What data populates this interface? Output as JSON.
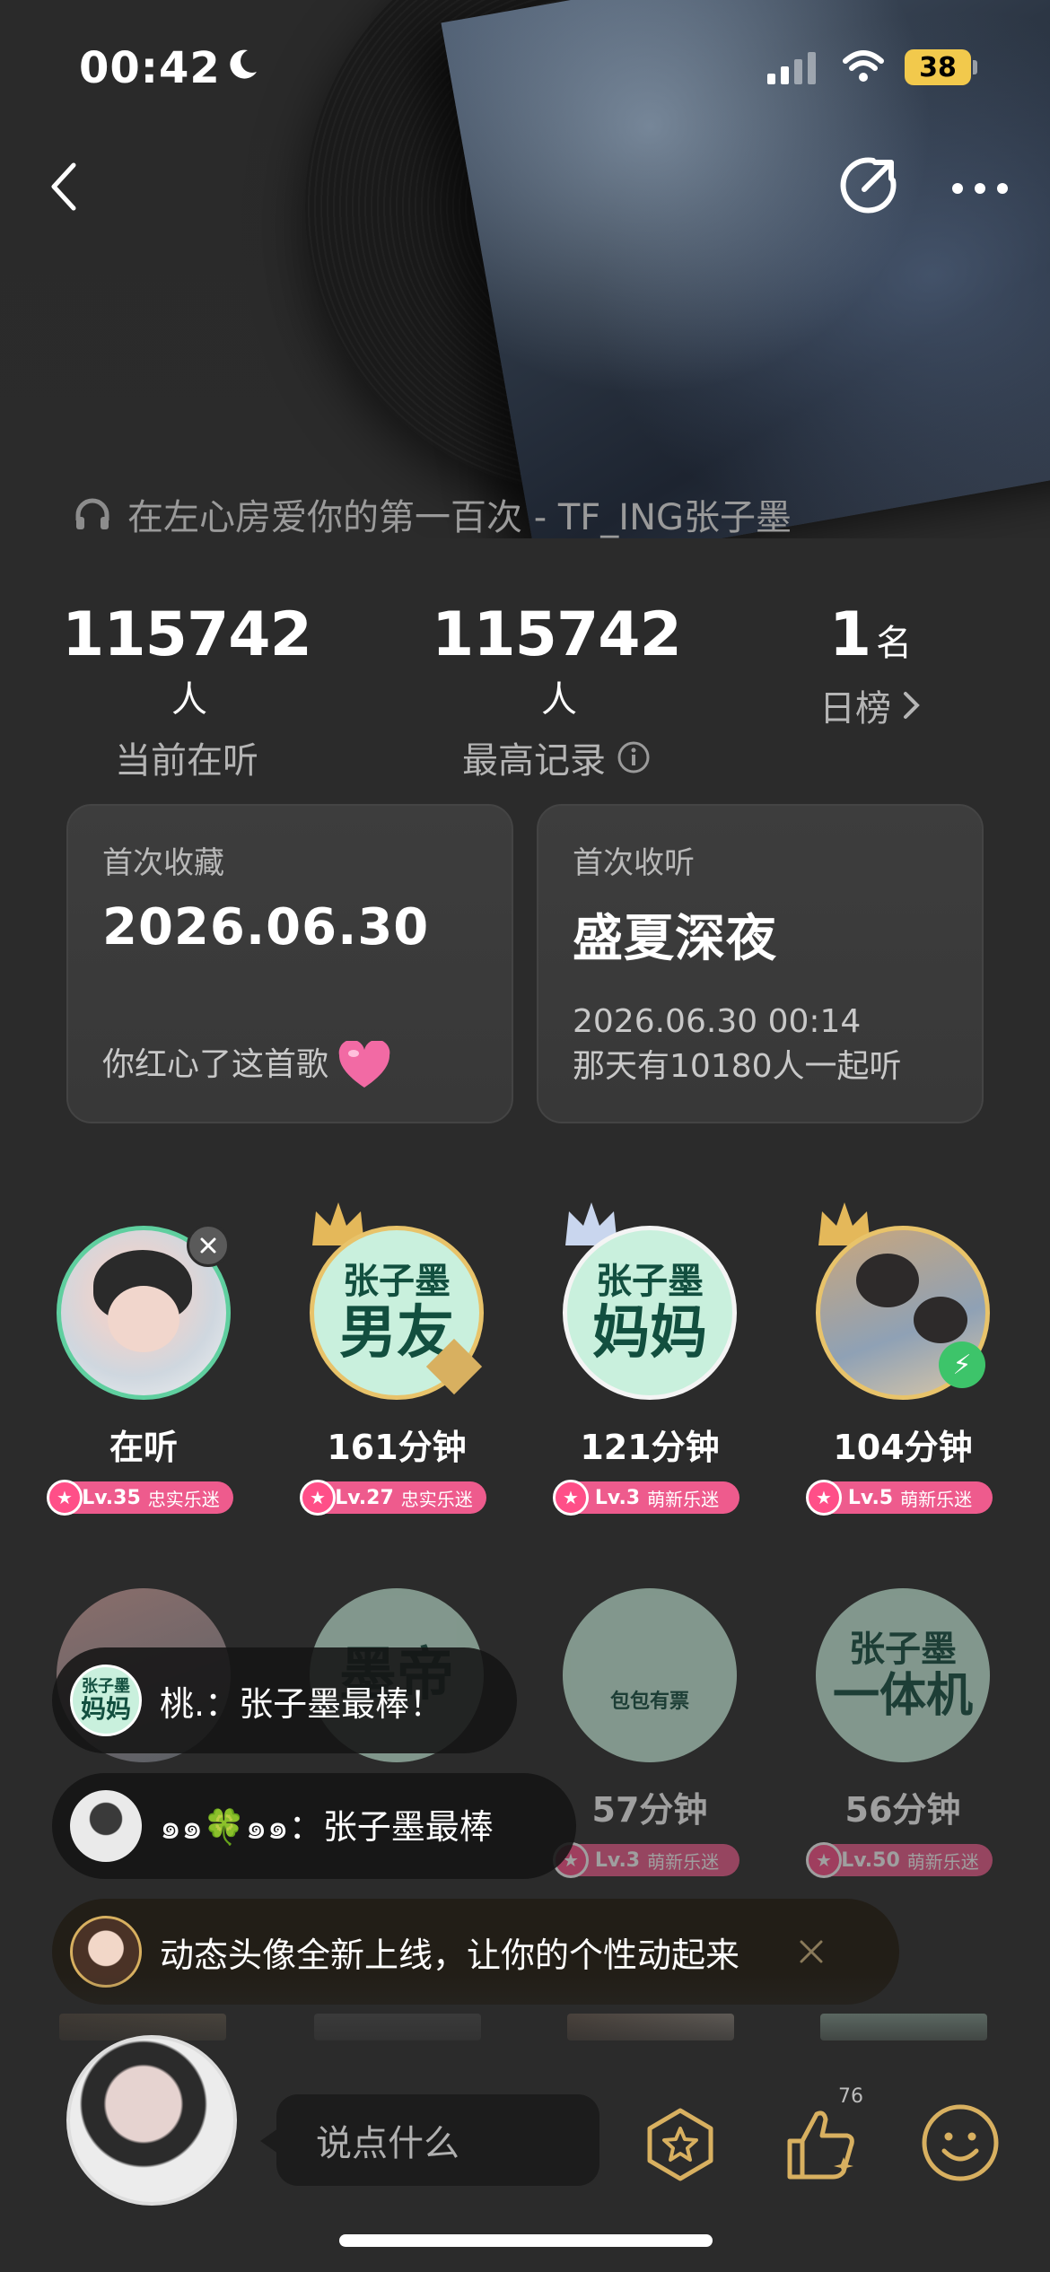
{
  "status_bar": {
    "time": "00:42",
    "battery": "38"
  },
  "song": {
    "title": "在左心房爱你的第一百次 - TF_ING张子墨"
  },
  "stats": [
    {
      "value": "115742",
      "unit": "人",
      "label": "当前在听"
    },
    {
      "value": "115742",
      "unit": "人",
      "label": "最高记录"
    },
    {
      "value": "1",
      "unit": "名",
      "label": "日榜"
    }
  ],
  "cards": {
    "first_fav": {
      "caption": "首次收藏",
      "date": "2026.06.30",
      "note": "你红心了这首歌"
    },
    "first_listen": {
      "caption": "首次收听",
      "title": "盛夏深夜",
      "time": "2026.06.30 00:14",
      "note": "那天有10180人一起听"
    }
  },
  "listeners": [
    {
      "name": "在听",
      "level": "Lv.35",
      "tier": "忠实乐迷"
    },
    {
      "name": "161分钟",
      "level": "Lv.27",
      "tier": "忠实乐迷",
      "badge_top": "张子墨",
      "badge_bottom": "男友"
    },
    {
      "name": "121分钟",
      "level": "Lv.3",
      "tier": "萌新乐迷",
      "badge_top": "张子墨",
      "badge_bottom": "妈妈"
    },
    {
      "name": "104分钟",
      "level": "Lv.5",
      "tier": "萌新乐迷"
    }
  ],
  "listeners_row2": [
    {
      "name": "",
      "level": "",
      "badge_top": ""
    },
    {
      "name": "",
      "level": "",
      "badge_top": "墨帝"
    },
    {
      "name": "57分钟",
      "level": "Lv.3",
      "tier": "萌新乐迷",
      "badge_text": "包包有票"
    },
    {
      "name": "56分钟",
      "level": "Lv.50",
      "tier": "萌新乐迷",
      "badge_top": "张子墨",
      "badge_bottom": "一体机"
    }
  ],
  "comments": [
    {
      "avatar_top": "张子墨",
      "avatar_bottom": "妈妈",
      "text": "桃.：张子墨最棒！"
    },
    {
      "text": "๑๑🍀๑๑：张子墨最棒"
    }
  ],
  "notice": {
    "text": "动态头像全新上线，让你的个性动起来"
  },
  "bottom": {
    "say_placeholder": "说点什么",
    "like_count": "76"
  },
  "colors": {
    "background": "#2b2b2b",
    "level_pink": "#ee5b8d",
    "badge_mint": "#c9f0dd",
    "gold": "#d8b060"
  }
}
